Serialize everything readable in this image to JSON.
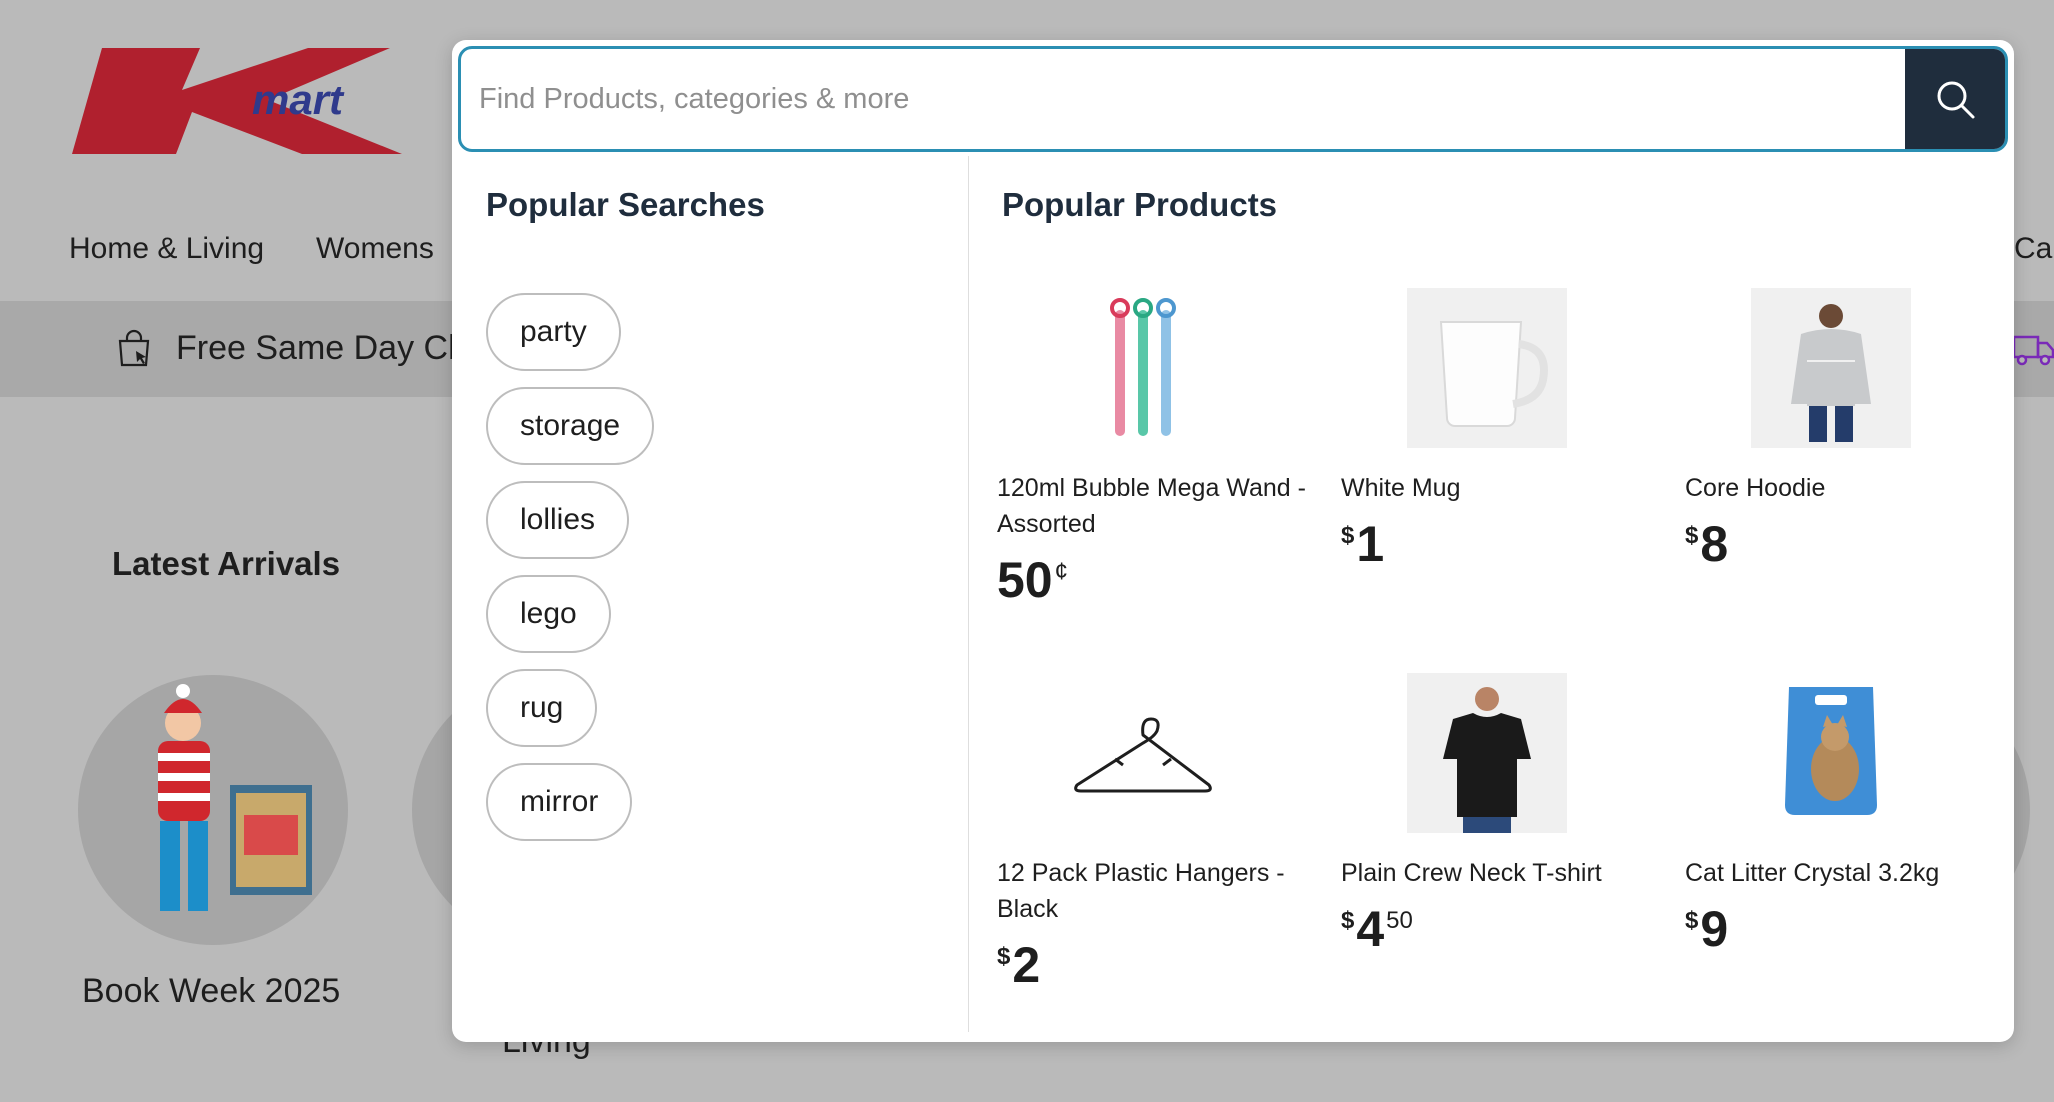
{
  "brand": {
    "logo_text": "Kmart",
    "logo_color": "#b0202e"
  },
  "nav": {
    "items": [
      "Home & Living",
      "Womens",
      "Ca"
    ]
  },
  "promo": {
    "text": "Free Same Day Cl"
  },
  "latest_arrivals": {
    "title": "Latest Arrivals",
    "items": [
      {
        "label": "Book Week 2025"
      },
      {
        "label": "Living"
      }
    ]
  },
  "search": {
    "placeholder": "Find Products, categories & more",
    "value": "",
    "accent_color": "#2b8fb3",
    "button_color": "#1f2d3d"
  },
  "popular_searches": {
    "title": "Popular Searches",
    "items": [
      "party",
      "storage",
      "lollies",
      "lego",
      "rug",
      "mirror"
    ]
  },
  "popular_products": {
    "title": "Popular Products",
    "items": [
      {
        "name": "120ml Bubble Mega Wand - Assorted",
        "currency": "",
        "amount": "50",
        "cents": "¢",
        "icon": "bubble-wand-icon"
      },
      {
        "name": "White Mug",
        "currency": "$",
        "amount": "1",
        "cents": "",
        "icon": "mug-icon"
      },
      {
        "name": "Core Hoodie",
        "currency": "$",
        "amount": "8",
        "cents": "",
        "icon": "hoodie-icon"
      },
      {
        "name": "12 Pack Plastic Hangers - Black",
        "currency": "$",
        "amount": "2",
        "cents": "",
        "icon": "hanger-icon"
      },
      {
        "name": "Plain Crew Neck T-shirt",
        "currency": "$",
        "amount": "4",
        "cents": "50",
        "icon": "tshirt-icon"
      },
      {
        "name": "Cat Litter Crystal 3.2kg",
        "currency": "$",
        "amount": "9",
        "cents": "",
        "icon": "cat-litter-icon"
      }
    ]
  }
}
